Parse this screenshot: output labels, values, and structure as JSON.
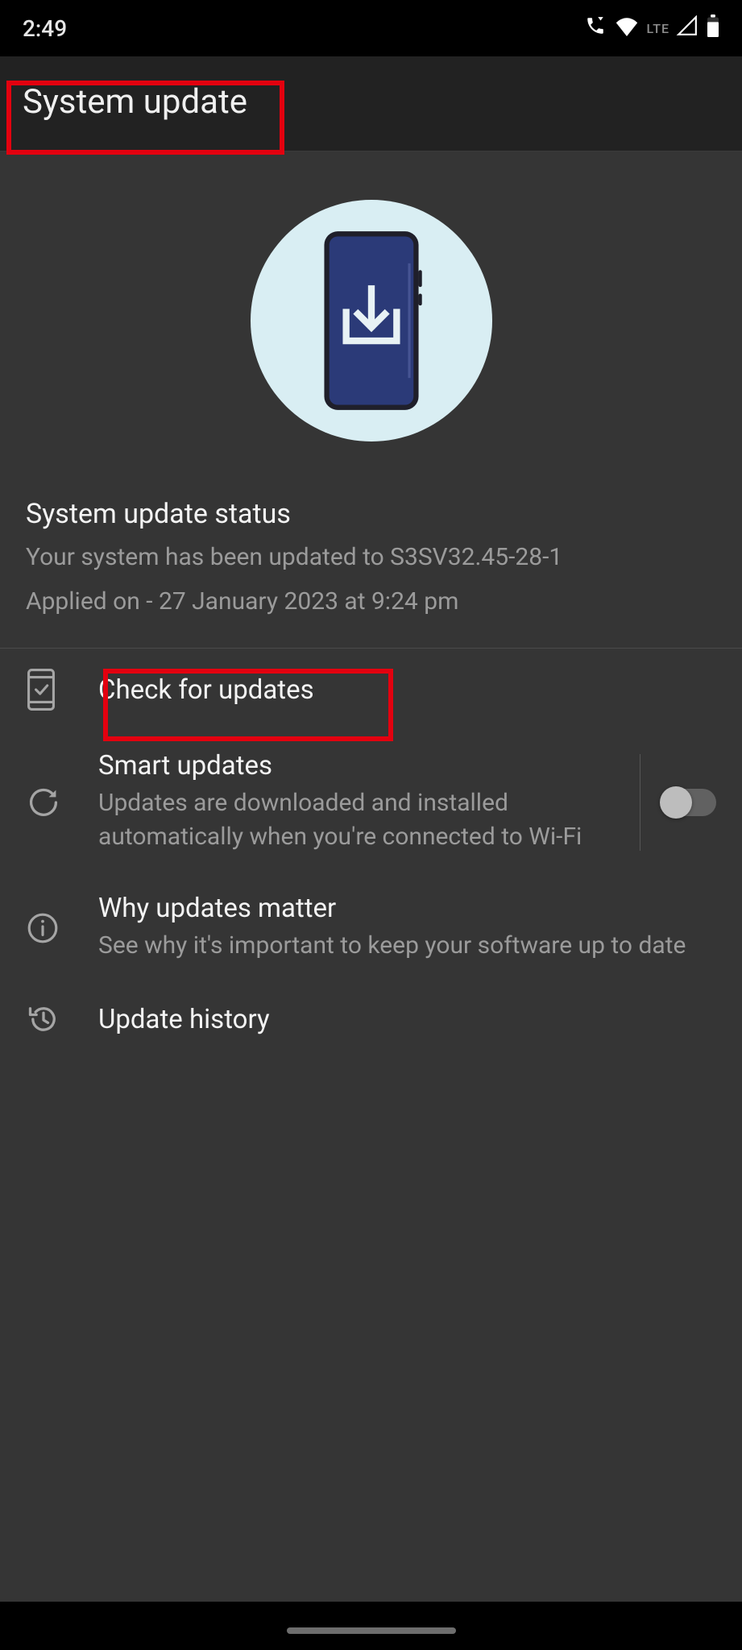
{
  "status_bar": {
    "time": "2:49",
    "network_label": "LTE"
  },
  "header": {
    "title": "System update"
  },
  "status": {
    "title": "System update status",
    "version_line": "Your system has been updated to S3SV32.45-28-1",
    "applied_line": "Applied on - 27 January 2023 at 9:24 pm"
  },
  "items": {
    "check": {
      "title": "Check for updates"
    },
    "smart": {
      "title": "Smart updates",
      "sub": "Updates are downloaded and installed automatically when you're connected to Wi-Fi",
      "toggle_on": false
    },
    "why": {
      "title": "Why updates matter",
      "sub": "See why it's important to keep your software up to date"
    },
    "history": {
      "title": "Update history"
    }
  }
}
